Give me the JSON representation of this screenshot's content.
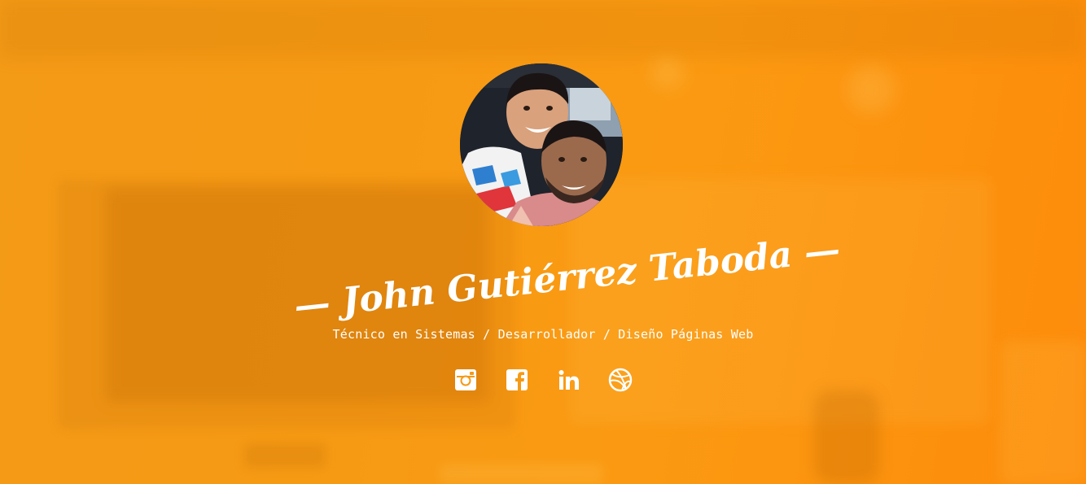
{
  "profile": {
    "name": "— John Gutiérrez Taboda —",
    "subtitle": "Técnico en Sistemas / Desarrollador / Diseño Páginas Web"
  },
  "social": [
    {
      "icon": "instagram-icon"
    },
    {
      "icon": "facebook-icon"
    },
    {
      "icon": "linkedin-icon"
    },
    {
      "icon": "dribbble-icon"
    }
  ],
  "colors": {
    "background": "#f69a14",
    "text": "#ffffff"
  }
}
